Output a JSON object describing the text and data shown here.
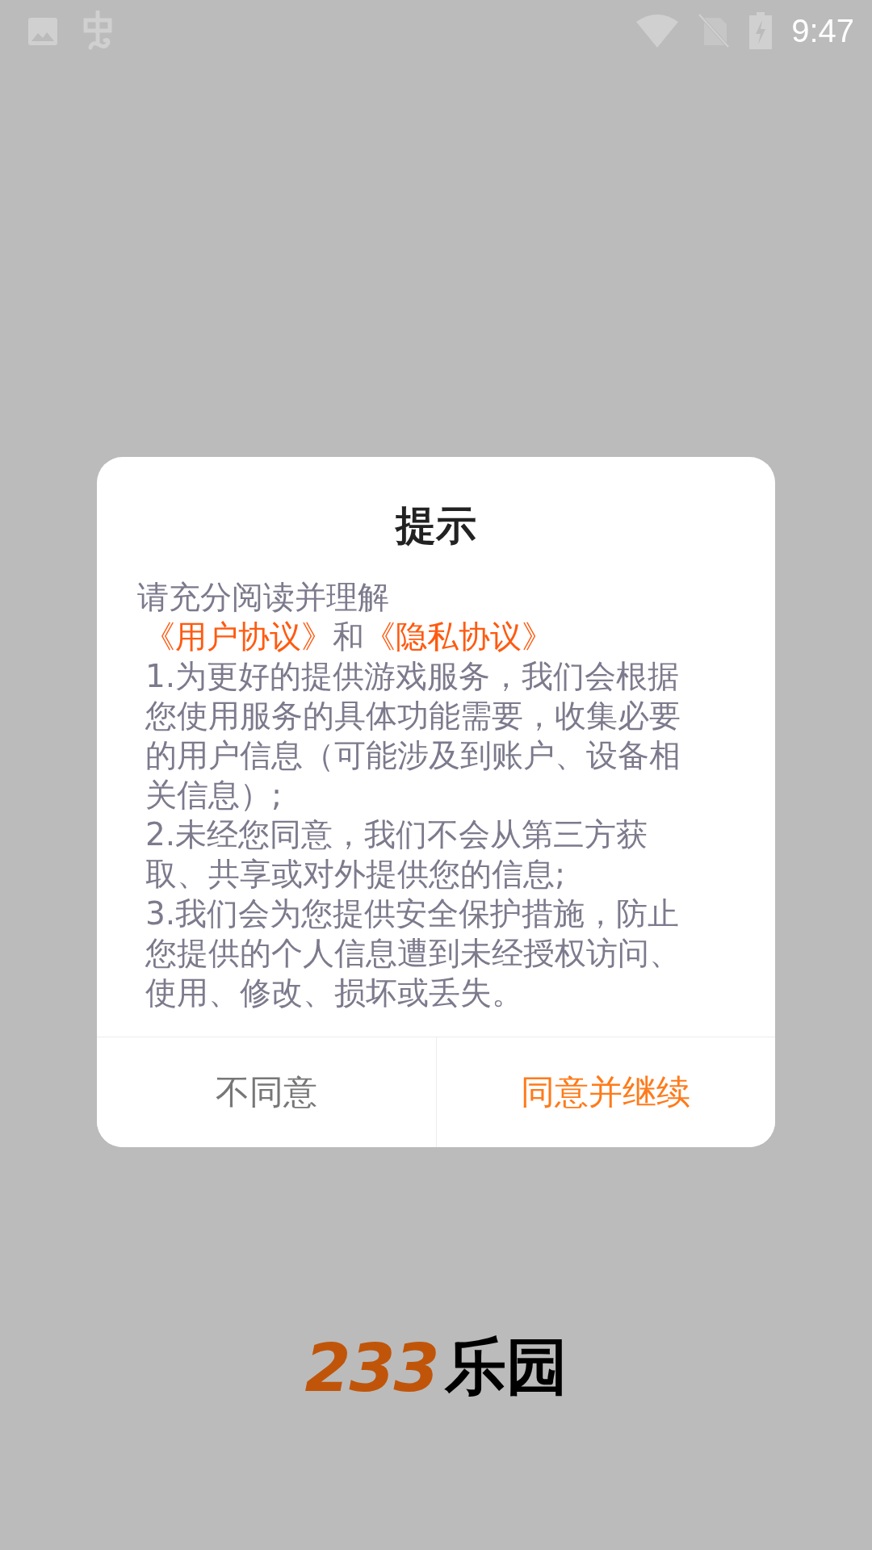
{
  "status_bar": {
    "time": "9:47"
  },
  "dialog": {
    "title": "提示",
    "intro": "请充分阅读并理解",
    "agreements": [
      {
        "kind": "link",
        "text": "《用户协议》"
      },
      {
        "kind": "text",
        "text": "和"
      },
      {
        "kind": "link",
        "text": "《隐私协议》"
      }
    ],
    "items": [
      "1.为更好的提供游戏服务，我们会根据您使用服务的具体功能需要，收集必要的用户信息（可能涉及到账户、设备相关信息）;",
      "2.未经您同意，我们不会从第三方获取、共享或对外提供您的信息;",
      "3.我们会为您提供安全保护措施，防止您提供的个人信息遭到未经授权访问、使用、修改、损坏或丢失。"
    ],
    "buttons": [
      {
        "label": "不同意",
        "primary": false
      },
      {
        "label": "同意并继续",
        "primary": true
      }
    ]
  },
  "logo": {
    "number": "233",
    "name": "乐园"
  }
}
